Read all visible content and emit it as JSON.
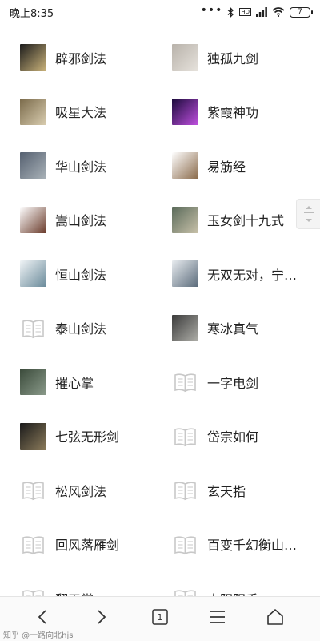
{
  "status_bar": {
    "time": "晚上8:35",
    "dots": "•••",
    "hd_label": "HD",
    "battery": "7"
  },
  "grid": [
    {
      "left": {
        "name": "辟邪剑法",
        "thumb": "photo",
        "colors": [
          "#1b1b1b",
          "#c9b27a"
        ]
      },
      "right": {
        "name": "独孤九剑",
        "thumb": "photo",
        "colors": [
          "#b8b2aa",
          "#e6e2dc"
        ]
      }
    },
    {
      "left": {
        "name": "吸星大法",
        "thumb": "photo",
        "colors": [
          "#7a6a4a",
          "#d9cdb0"
        ]
      },
      "right": {
        "name": "紫霞神功",
        "thumb": "photo",
        "colors": [
          "#1a0a3a",
          "#c050e0"
        ]
      }
    },
    {
      "left": {
        "name": "华山剑法",
        "thumb": "photo",
        "colors": [
          "#556070",
          "#a9b2b8"
        ]
      },
      "right": {
        "name": "易筋经",
        "thumb": "photo",
        "colors": [
          "#ffffff",
          "#8a6a4a"
        ]
      }
    },
    {
      "left": {
        "name": "嵩山剑法",
        "thumb": "photo",
        "colors": [
          "#ffffff",
          "#6a3a2a"
        ]
      },
      "right": {
        "name": "玉女剑十九式",
        "thumb": "photo",
        "colors": [
          "#5a6a5a",
          "#c9c2aa"
        ]
      }
    },
    {
      "left": {
        "name": "恒山剑法",
        "thumb": "photo",
        "colors": [
          "#f0f4f6",
          "#6a8a9a"
        ]
      },
      "right": {
        "name": "无双无对，宁氏一剑",
        "thumb": "photo",
        "colors": [
          "#e8ecef",
          "#5a6a7a"
        ]
      }
    },
    {
      "left": {
        "name": "泰山剑法",
        "thumb": "book"
      },
      "right": {
        "name": "寒冰真气",
        "thumb": "photo",
        "colors": [
          "#3a3a3a",
          "#b0b0aa"
        ]
      }
    },
    {
      "left": {
        "name": "摧心掌",
        "thumb": "photo",
        "colors": [
          "#3a4a3a",
          "#8a9a8a"
        ]
      },
      "right": {
        "name": "一字电剑",
        "thumb": "book"
      }
    },
    {
      "left": {
        "name": "七弦无形剑",
        "thumb": "photo",
        "colors": [
          "#1a1a1a",
          "#8a7a5a"
        ]
      },
      "right": {
        "name": "岱宗如何",
        "thumb": "book"
      }
    },
    {
      "left": {
        "name": "松风剑法",
        "thumb": "book"
      },
      "right": {
        "name": "玄天指",
        "thumb": "book"
      }
    },
    {
      "left": {
        "name": "回风落雁剑",
        "thumb": "book"
      },
      "right": {
        "name": "百变千幻衡山云雾十三式",
        "thumb": "book"
      }
    },
    {
      "left": {
        "name": "翻天掌",
        "thumb": "book"
      },
      "right": {
        "name": "大阴阳手",
        "thumb": "book"
      }
    }
  ],
  "bottom_nav": {
    "tab_count": "1"
  },
  "watermark": "知乎 @一路向北hjs"
}
